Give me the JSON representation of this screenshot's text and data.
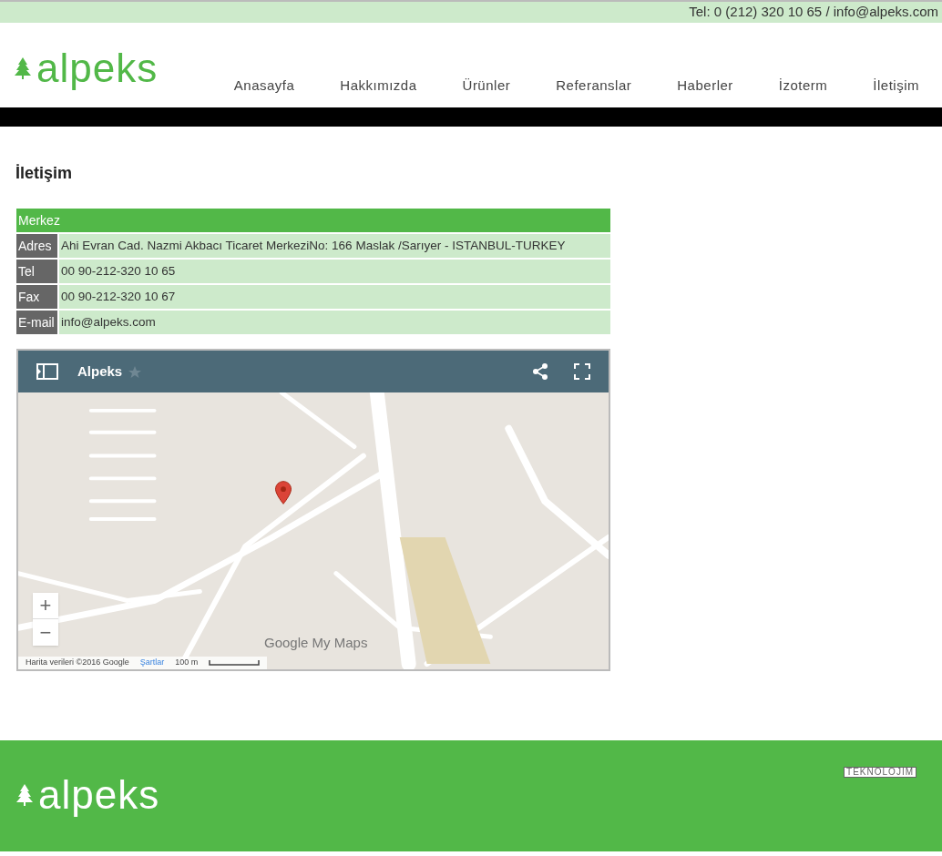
{
  "top_bar": {
    "contact": "Tel: 0 (212) 320 10 65 / info@alpeks.com"
  },
  "header": {
    "logo": "alpeks",
    "nav": [
      {
        "label": "Anasayfa",
        "selected": false
      },
      {
        "label": "Hakkımızda",
        "selected": false
      },
      {
        "label": "Ürünler",
        "selected": false
      },
      {
        "label": "Referanslar",
        "selected": false
      },
      {
        "label": "Haberler",
        "selected": false
      },
      {
        "label": "İzoterm",
        "selected": false
      },
      {
        "label": "İletişim",
        "selected": false
      }
    ]
  },
  "page_title": "İletişim",
  "contact_table": {
    "heading": "Merkez",
    "rows": [
      {
        "label": "Adres",
        "value": "Ahi Evran Cad. Nazmi Akbacı Ticaret MerkeziNo: 166  Maslak /Sarıyer  - ISTANBUL-TURKEY"
      },
      {
        "label": "Tel",
        "value": "00 90-212-320 10 65"
      },
      {
        "label": "Fax",
        "value": "00 90-212-320 10 67"
      },
      {
        "label": "E-mail",
        "value": "info@alpeks.com"
      }
    ]
  },
  "map": {
    "title": "Alpeks",
    "starred": false,
    "zoom_in": "+",
    "zoom_out": "−",
    "brand": "Google My Maps",
    "attribution": "Harita verileri ©2016 Google",
    "terms": "Şartlar",
    "scale": "100 m"
  },
  "footer": {
    "logo": "alpeks",
    "credit": "TEKNOLOJIM"
  }
}
